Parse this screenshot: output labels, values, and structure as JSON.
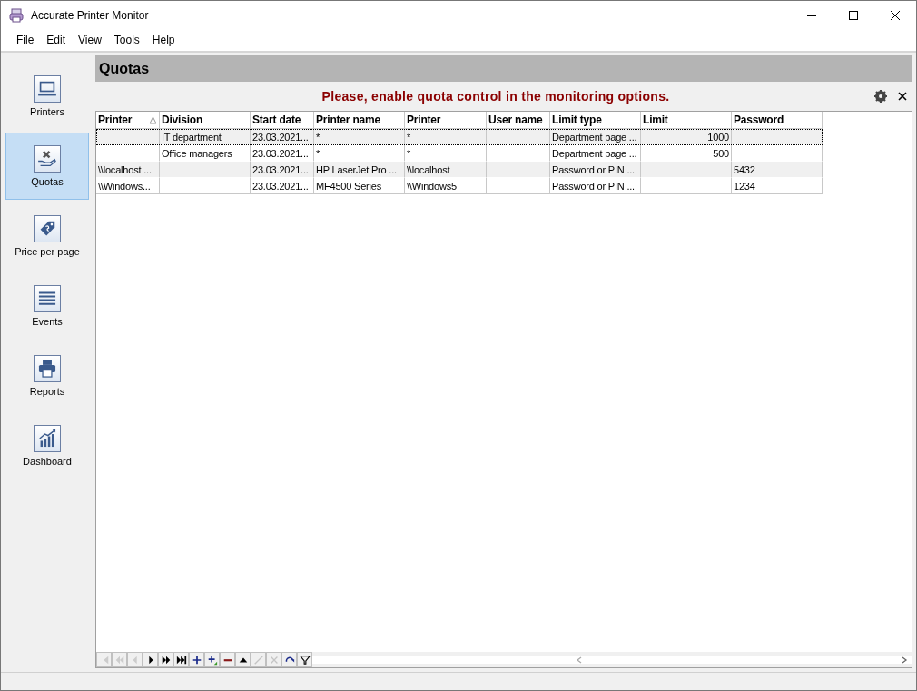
{
  "window": {
    "title": "Accurate Printer Monitor"
  },
  "menu": [
    "File",
    "Edit",
    "View",
    "Tools",
    "Help"
  ],
  "sidebar": {
    "items": [
      {
        "label": "Printers",
        "kind": "laptop",
        "selected": false
      },
      {
        "label": "Quotas",
        "kind": "quota",
        "selected": true
      },
      {
        "label": "Price per page",
        "kind": "price",
        "selected": false
      },
      {
        "label": "Events",
        "kind": "list",
        "selected": false
      },
      {
        "label": "Reports",
        "kind": "printer",
        "selected": false
      },
      {
        "label": "Dashboard",
        "kind": "chart",
        "selected": false
      }
    ]
  },
  "panel": {
    "title": "Quotas",
    "message": "Please, enable quota control in the monitoring options."
  },
  "table": {
    "columns": [
      {
        "label": "Printer",
        "sorted": true,
        "numeric": false
      },
      {
        "label": "Division",
        "sorted": false,
        "numeric": false
      },
      {
        "label": "Start date",
        "sorted": false,
        "numeric": false
      },
      {
        "label": "Printer name",
        "sorted": false,
        "numeric": false
      },
      {
        "label": "Printer",
        "sorted": false,
        "numeric": false
      },
      {
        "label": "User name",
        "sorted": false
      },
      {
        "label": "Limit type",
        "sorted": false,
        "numeric": false
      },
      {
        "label": "Limit",
        "sorted": false,
        "numeric": true
      },
      {
        "label": "Password",
        "sorted": false,
        "numeric": false
      }
    ],
    "rows": [
      {
        "selected": true,
        "cells": [
          "",
          "IT department",
          "23.03.2021...",
          "*",
          "*",
          "",
          "Department page ...",
          "1000",
          ""
        ]
      },
      {
        "selected": false,
        "cells": [
          "",
          "Office managers",
          "23.03.2021...",
          "*",
          "*",
          "",
          "Department page ...",
          "500",
          ""
        ]
      },
      {
        "selected": false,
        "cells": [
          "\\\\localhost ...",
          "",
          "23.03.2021...",
          "HP LaserJet Pro ...",
          "\\\\localhost",
          "",
          "Password or PIN ...",
          "",
          "5432"
        ]
      },
      {
        "selected": false,
        "cells": [
          "\\\\Windows...",
          "",
          "23.03.2021...",
          "MF4500 Series",
          "\\\\Windows5",
          "",
          "Password or PIN ...",
          "",
          "1234"
        ]
      }
    ]
  },
  "navigator": {
    "buttons": [
      {
        "kind": "first",
        "disabled": true
      },
      {
        "kind": "prior-page",
        "disabled": true
      },
      {
        "kind": "prior",
        "disabled": true
      },
      {
        "kind": "next",
        "disabled": false
      },
      {
        "kind": "next-page",
        "disabled": false
      },
      {
        "kind": "last",
        "disabled": false
      },
      {
        "kind": "insert",
        "disabled": false
      },
      {
        "kind": "append",
        "disabled": false
      },
      {
        "kind": "delete",
        "disabled": false
      },
      {
        "kind": "edit",
        "disabled": false
      },
      {
        "kind": "post",
        "disabled": true
      },
      {
        "kind": "cancel",
        "disabled": true
      },
      {
        "kind": "refresh",
        "disabled": false
      },
      {
        "kind": "filter",
        "disabled": false
      }
    ]
  }
}
